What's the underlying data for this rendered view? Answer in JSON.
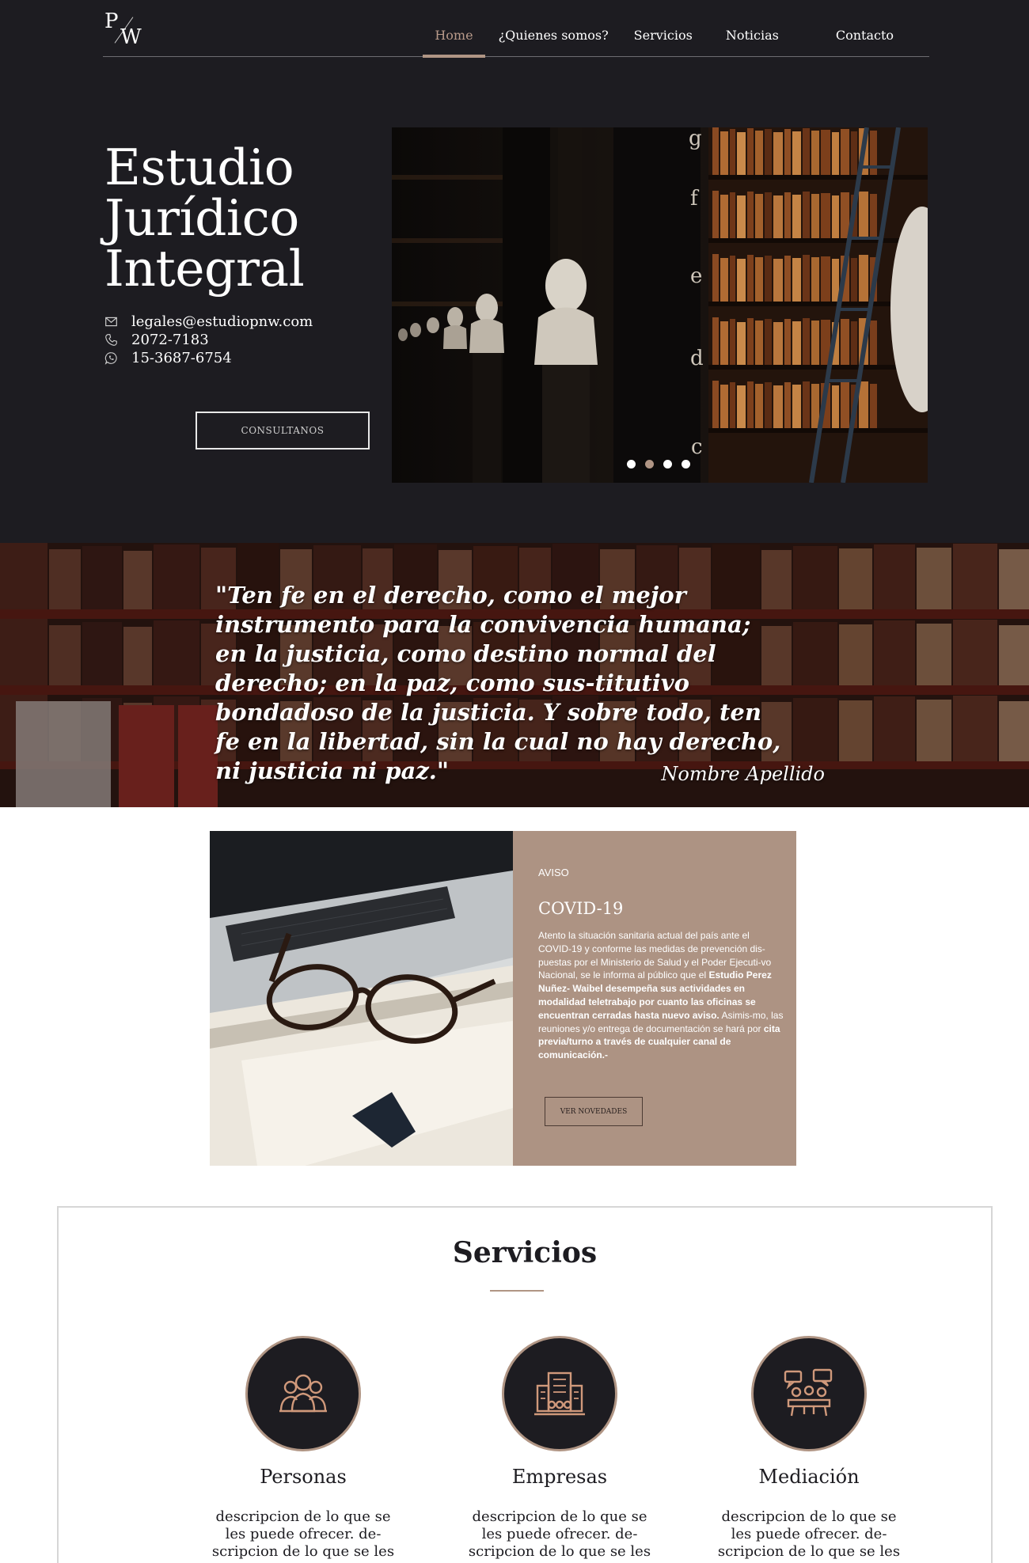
{
  "colors": {
    "dark": "#1d1c21",
    "accent": "#b09584",
    "panel": "#ad9383"
  },
  "header": {
    "logo": {
      "top_letter": "P",
      "bottom_letter": "W"
    },
    "nav": [
      {
        "label": "Home",
        "active": true
      },
      {
        "label": "¿Quienes somos?",
        "active": false
      },
      {
        "label": "Servicios",
        "active": false
      },
      {
        "label": "Noticias",
        "active": false
      },
      {
        "label": "Contacto",
        "active": false
      }
    ]
  },
  "hero": {
    "title_lines": [
      "Estudio",
      "Jurídico",
      "Integral"
    ],
    "contacts": [
      {
        "icon": "envelope-icon",
        "text": "legales@estudiopnw.com"
      },
      {
        "icon": "phone-icon",
        "text": "2072-7183"
      },
      {
        "icon": "whatsapp-icon",
        "text": "15-3687-6754"
      }
    ],
    "cta_label": "CONSULTANOS",
    "slider_book_letters": [
      "g",
      "f",
      "e",
      "d",
      "c"
    ],
    "slider_dots": 4,
    "slider_active_dot": 1
  },
  "quote": {
    "text": "\"Ten fe en el derecho, como el mejor instrumento para la convivencia humana; en la justicia, como destino normal del derecho; en la paz, como sus-titutivo bondadoso de la justicia. Y sobre todo, ten fe en la libertad, sin la cual no hay derecho, ni justicia ni paz.\"",
    "author": "Nombre Apellido"
  },
  "notice": {
    "kicker": "AVISO",
    "title": "COVID-19",
    "body_plain_1": "Atento la situación sanitaria actual del país ante el COVID-19 y conforme las medidas de prevención dis-puestas por el Ministerio de Salud y el Poder Ejecuti-vo Nacional, se le informa al público que el ",
    "body_bold_1": "Estudio Perez Nuñez- Waibel desempeña sus actividades en modalidad teletrabajo por cuanto las oficinas se encuentran cerradas hasta nuevo aviso.",
    "body_plain_2": " Asimis-mo, las reuniones y/o entrega de documentación se hará por ",
    "body_bold_2": "cita previa/turno a través de cualquier canal de comunicación.-",
    "button_label": "VER NOVEDADES"
  },
  "services": {
    "title": "Servicios",
    "items": [
      {
        "icon": "people-icon",
        "name": "Personas",
        "desc_lines": [
          "descripcion de lo que se",
          "les puede ofrecer. de-",
          "scripcion de lo que se les"
        ]
      },
      {
        "icon": "building-icon",
        "name": "Empresas",
        "desc_lines": [
          "descripcion de lo que se",
          "les puede ofrecer. de-",
          "scripcion de lo que se les"
        ]
      },
      {
        "icon": "meeting-icon",
        "name": "Mediación",
        "desc_lines": [
          "descripcion de lo que se",
          "les puede ofrecer. de-",
          "scripcion de lo que se les"
        ]
      }
    ]
  }
}
